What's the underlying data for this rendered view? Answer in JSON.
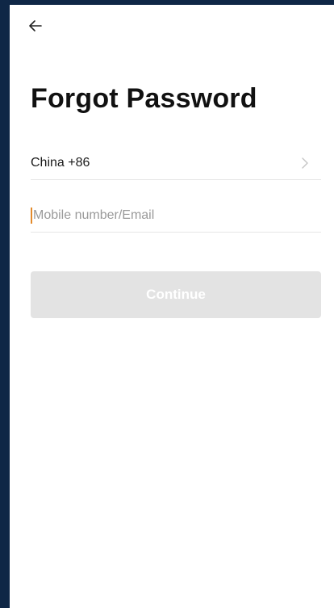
{
  "header": {
    "back_icon": "arrow-left-icon"
  },
  "page": {
    "title": "Forgot Password"
  },
  "form": {
    "country": "China +86",
    "chevron_icon": "chevron-right-icon",
    "account_placeholder": "Mobile number/Email",
    "account_value": "",
    "continue_label": "Continue"
  },
  "colors": {
    "frame_bg": "#0f2746",
    "screen_bg": "#ffffff",
    "caret": "#e38a2b",
    "button_disabled": "#e3e3e3",
    "divider": "#e6e6e6"
  }
}
